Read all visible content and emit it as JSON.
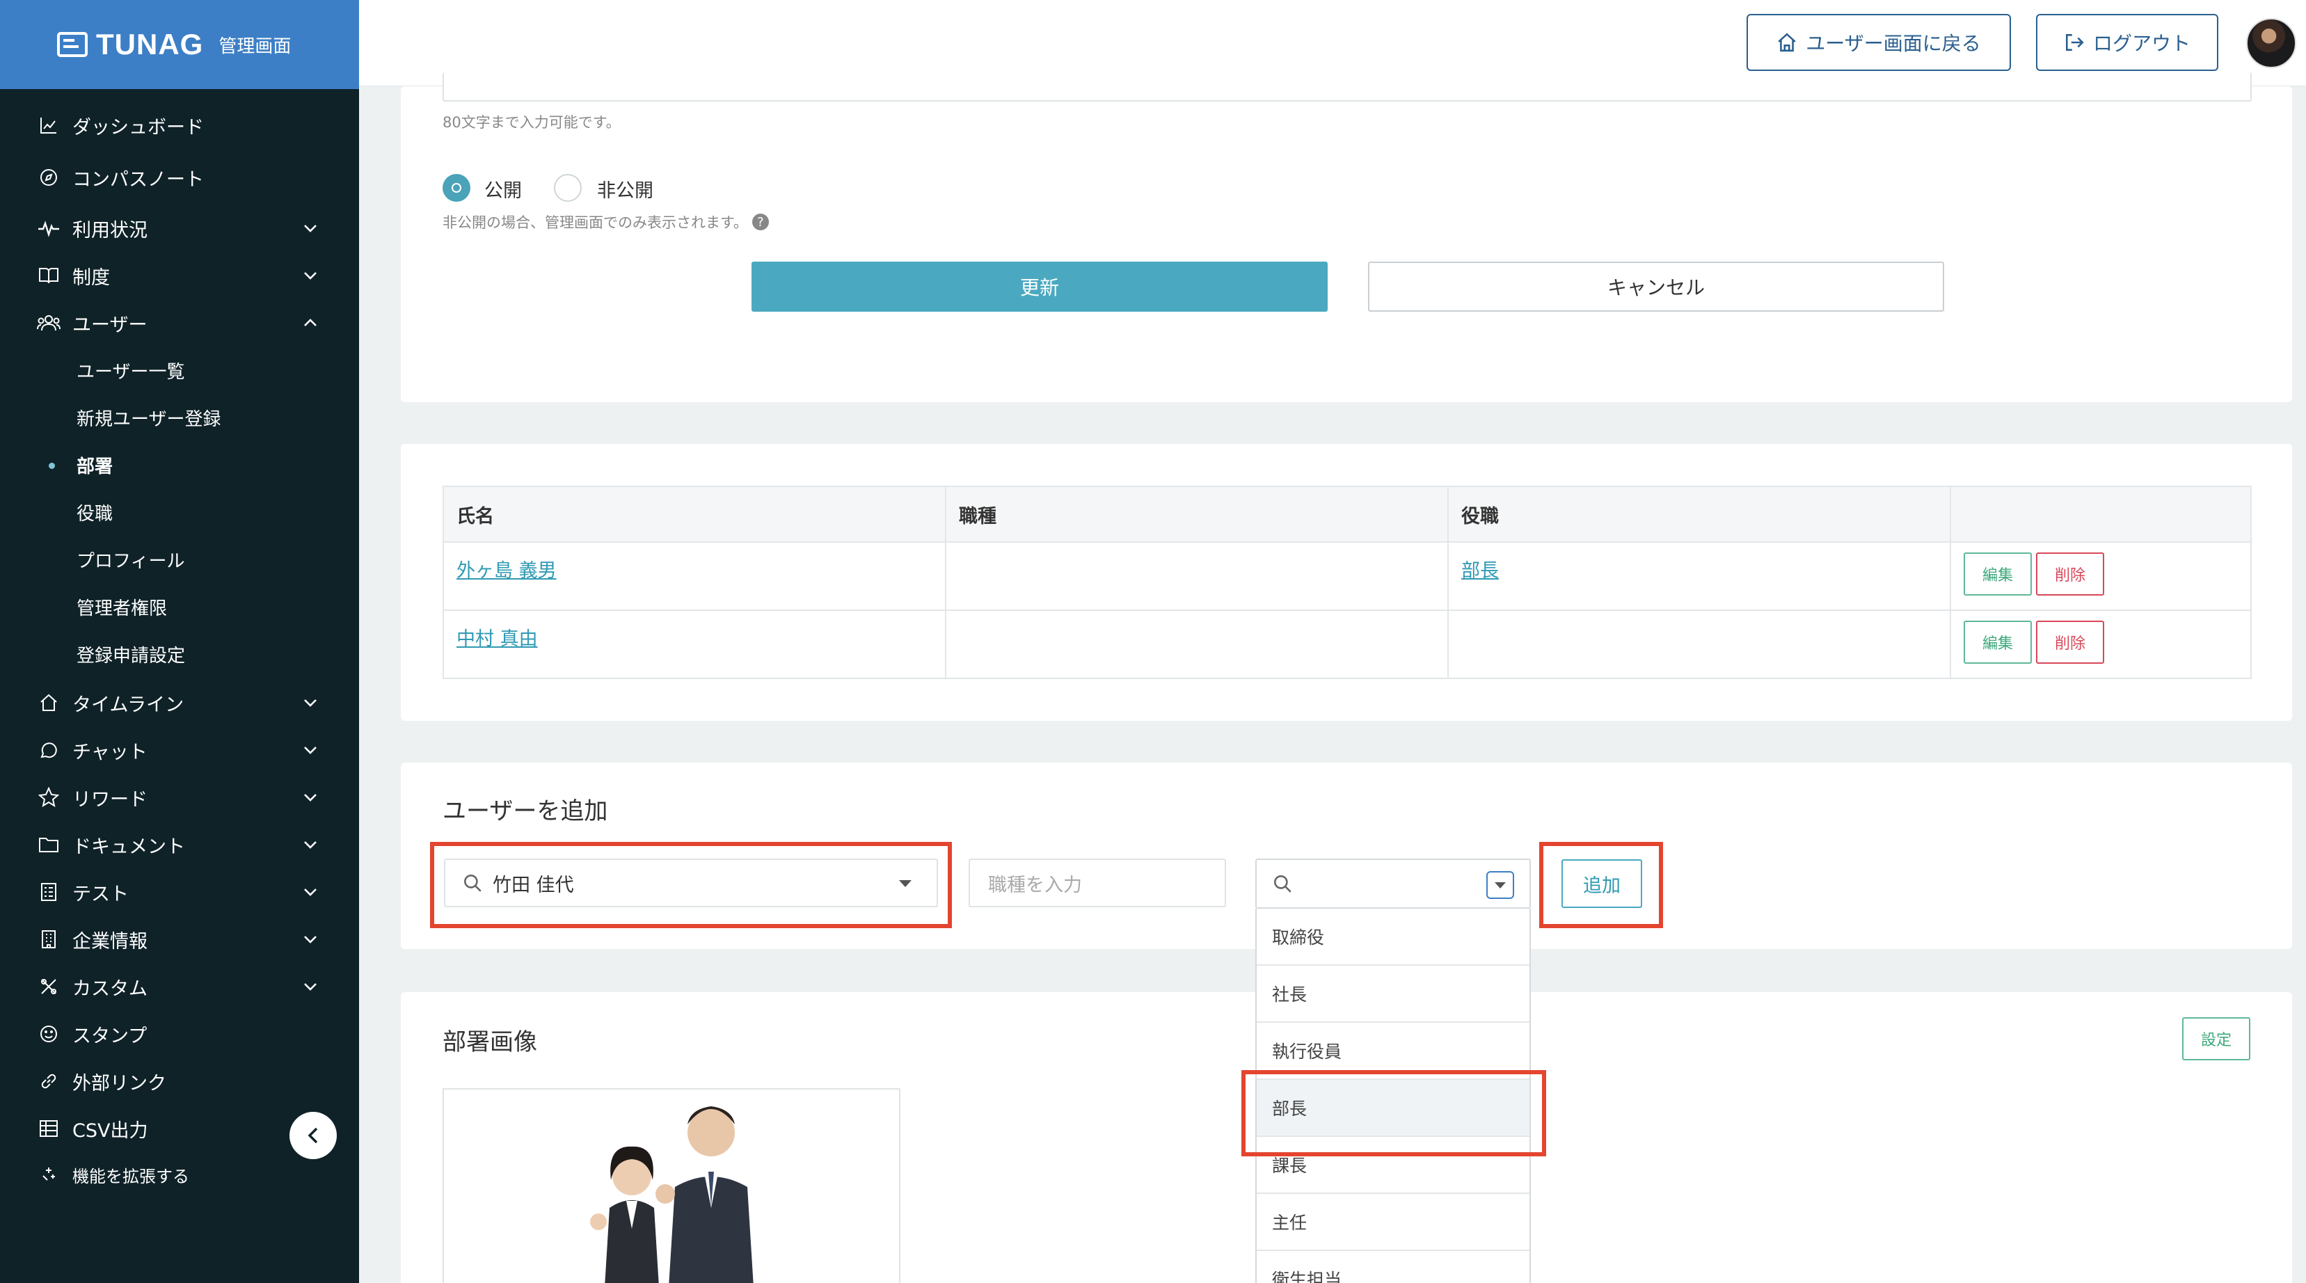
{
  "brand": {
    "logo": "TUNAG",
    "subtitle": "管理画面"
  },
  "sidebar": {
    "items": [
      {
        "label": "ダッシュボード",
        "icon": "chart-line-icon"
      },
      {
        "label": "コンパスノート",
        "icon": "compass-icon"
      },
      {
        "label": "利用状況",
        "icon": "pulse-icon"
      },
      {
        "label": "制度",
        "icon": "book-icon"
      },
      {
        "label": "ユーザー",
        "icon": "users-icon"
      },
      {
        "label": "タイムライン",
        "icon": "home-icon"
      },
      {
        "label": "チャット",
        "icon": "chat-icon"
      },
      {
        "label": "リワード",
        "icon": "star-icon"
      },
      {
        "label": "ドキュメント",
        "icon": "folder-icon"
      },
      {
        "label": "テスト",
        "icon": "test-icon"
      },
      {
        "label": "企業情報",
        "icon": "building-icon"
      },
      {
        "label": "カスタム",
        "icon": "tools-icon"
      },
      {
        "label": "スタンプ",
        "icon": "smile-icon"
      },
      {
        "label": "外部リンク",
        "icon": "link-icon"
      },
      {
        "label": "CSV出力",
        "icon": "table-icon"
      },
      {
        "label": "機能を拡張する",
        "icon": "sparkle-icon"
      }
    ],
    "user_sub": [
      "ユーザー一覧",
      "新規ユーザー登録",
      "部署",
      "役職",
      "プロフィール",
      "管理者権限",
      "登録申請設定"
    ]
  },
  "header": {
    "back_label": "ユーザー画面に戻る",
    "logout_label": "ログアウト"
  },
  "form": {
    "char_note": "80文字まで入力可能です。",
    "public_label": "公開",
    "private_label": "非公開",
    "public_selected": "公開",
    "visibility_note": "非公開の場合、管理画面でのみ表示されます。",
    "update_label": "更新",
    "cancel_label": "キャンセル"
  },
  "members": {
    "headers": [
      "氏名",
      "職種",
      "役職",
      ""
    ],
    "rows": [
      {
        "name": "外ヶ島 義男",
        "job": "",
        "position": "部長",
        "edit": "編集",
        "delete": "削除"
      },
      {
        "name": "中村 真由",
        "job": "",
        "position": "",
        "edit": "編集",
        "delete": "削除"
      }
    ]
  },
  "add_user": {
    "title": "ユーザーを追加",
    "user_value": "竹田 佳代",
    "job_placeholder": "職種を入力",
    "add_label": "追加",
    "position_options": [
      "取締役",
      "社長",
      "執行役員",
      "部長",
      "課長",
      "主任",
      "衛生担当"
    ],
    "highlighted_option": "部長"
  },
  "department_image": {
    "title": "部署画像",
    "set_label": "設定"
  },
  "colors": {
    "sidebar_bg": "#0f2228",
    "brand_bg": "#3d7fc6",
    "accent": "#4aa9c0",
    "highlight_frame": "#e4452f",
    "delete": "#d9475a",
    "edit": "#3fa87d"
  }
}
